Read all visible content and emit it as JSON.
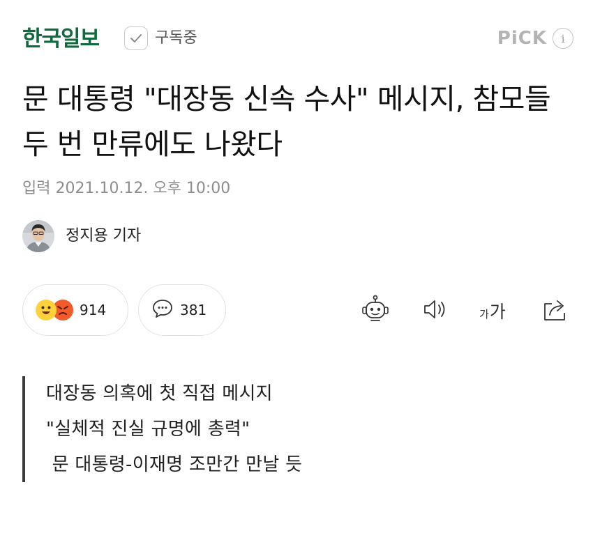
{
  "header": {
    "brand": "한국일보",
    "subscribe_label": "구독중",
    "pick_label": "PiCK",
    "info_glyph": "i"
  },
  "article": {
    "headline": "문 대통령 \"대장동 신속 수사\" 메시지, 참모들 두 번 만류에도 나왔다",
    "dateline": "입력 2021.10.12. 오후 10:00",
    "reporter": "정지용 기자"
  },
  "actions": {
    "reactions_count": "914",
    "comments_count": "381",
    "font_small": "가",
    "font_large": "가"
  },
  "summary": {
    "lines": [
      "대장동 의혹에 첫 직접 메시지",
      "\"실체적 진실 규명에 총력\"",
      " 문 대통령-이재명 조만간 만날 듯"
    ]
  },
  "icons": {
    "check": "check-icon",
    "info": "info-icon",
    "avatar": "reporter-avatar",
    "happy": "happy-emoji-icon",
    "angry": "angry-emoji-icon",
    "comment": "comment-bubble-icon",
    "bot": "robot-icon",
    "sound": "speaker-icon",
    "font": "font-size-icon",
    "share": "share-icon"
  },
  "colors": {
    "brand": "#0f6b3e",
    "pick": "#b3b3b3",
    "happy_emoji": "#ffd23c",
    "angry_emoji": "#f15a2b",
    "summary_bar": "#3c3c3c"
  }
}
